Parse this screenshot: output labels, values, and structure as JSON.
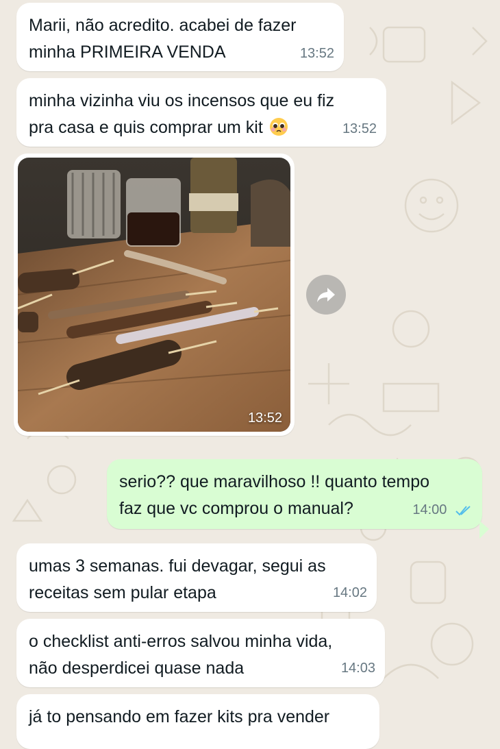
{
  "chat": {
    "messages": [
      {
        "text_lines": [
          "Marii, não acredito. acabei de fazer",
          "minha PRIMEIRA VENDA"
        ],
        "time": "13:52"
      },
      {
        "text_lines": [
          "minha vizinha viu os incensos que eu fiz",
          "pra casa e quis comprar um kit"
        ],
        "emoji": "pleading-face-emoji",
        "time": "13:52"
      },
      {
        "image": "incense-sticks-photo",
        "time": "13:52"
      },
      {
        "text_lines": [
          "serio?? que maravilhoso !! quanto tempo",
          "faz que vc comprou o manual?"
        ],
        "time": "14:00",
        "status": "read"
      },
      {
        "text_lines": [
          "umas 3 semanas. fui devagar, segui as",
          "receitas sem pular etapa"
        ],
        "time": "14:02"
      },
      {
        "text_lines": [
          "o checklist anti-erros salvou minha vida,",
          "não desperdicei quase nada"
        ],
        "time": "14:03"
      },
      {
        "text_lines": [
          "já to pensando em fazer kits pra vender"
        ]
      }
    ]
  },
  "colors": {
    "wallpaper": "#efeae2",
    "incoming_bubble": "#ffffff",
    "outgoing_bubble": "#d9fdd3",
    "read_ticks": "#53bdeb",
    "timestamp": "#667781"
  },
  "icons": {
    "forward": "forward-icon",
    "read_receipt": "double-check-icon"
  }
}
